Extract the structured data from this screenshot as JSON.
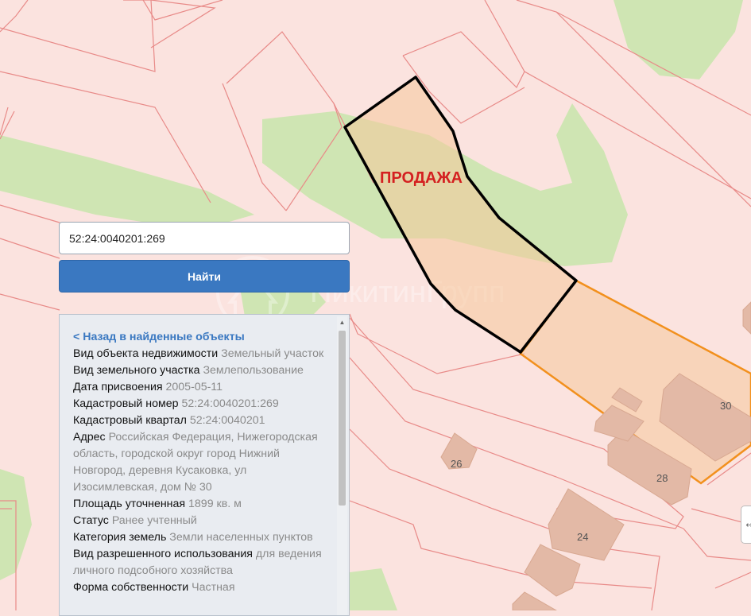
{
  "search": {
    "value": "52:24:0040201:269",
    "button_label": "Найти"
  },
  "map": {
    "sale_label": "ПРОДАЖА",
    "house_numbers": [
      "26",
      "28",
      "30",
      "24"
    ],
    "watermark": "НикитинГрупп",
    "colors": {
      "parcel_fill": "#fbe3df",
      "parcel_border": "#e88a88",
      "green": "#cfe5b3",
      "sale_outline": "#000000",
      "neighbor_outline": "#f2901d",
      "sale_text": "#d42020"
    }
  },
  "panel": {
    "back_link": "< Назад в найденные объекты",
    "rows": [
      {
        "label": "Вид объекта недвижимости",
        "value": "Земельный участок"
      },
      {
        "label": "Вид земельного участка",
        "value": "Землепользование"
      },
      {
        "label": "Дата присвоения",
        "value": "2005-05-11"
      },
      {
        "label": "Кадастровый номер",
        "value": "52:24:0040201:269"
      },
      {
        "label": "Кадастровый квартал",
        "value": "52:24:0040201"
      },
      {
        "label": "Адрес",
        "value": "Российская Федерация, Нижегородская область, городской округ город Нижний Новгород, деревня Кусаковка, ул Изосимлевская, дом № 30"
      },
      {
        "label": "Площадь уточненная",
        "value": "1899 кв. м"
      },
      {
        "label": "Статус",
        "value": "Ранее учтенный"
      },
      {
        "label": "Категория земель",
        "value": "Земли населенных пунктов"
      },
      {
        "label": "Вид разрешенного использования",
        "value": "для ведения личного подсобного хозяйства"
      },
      {
        "label": "Форма собственности",
        "value": "Частная"
      }
    ]
  },
  "icons": {
    "scroll_up": "chevron-up-icon",
    "side_handle": "expand-arrows-icon"
  }
}
